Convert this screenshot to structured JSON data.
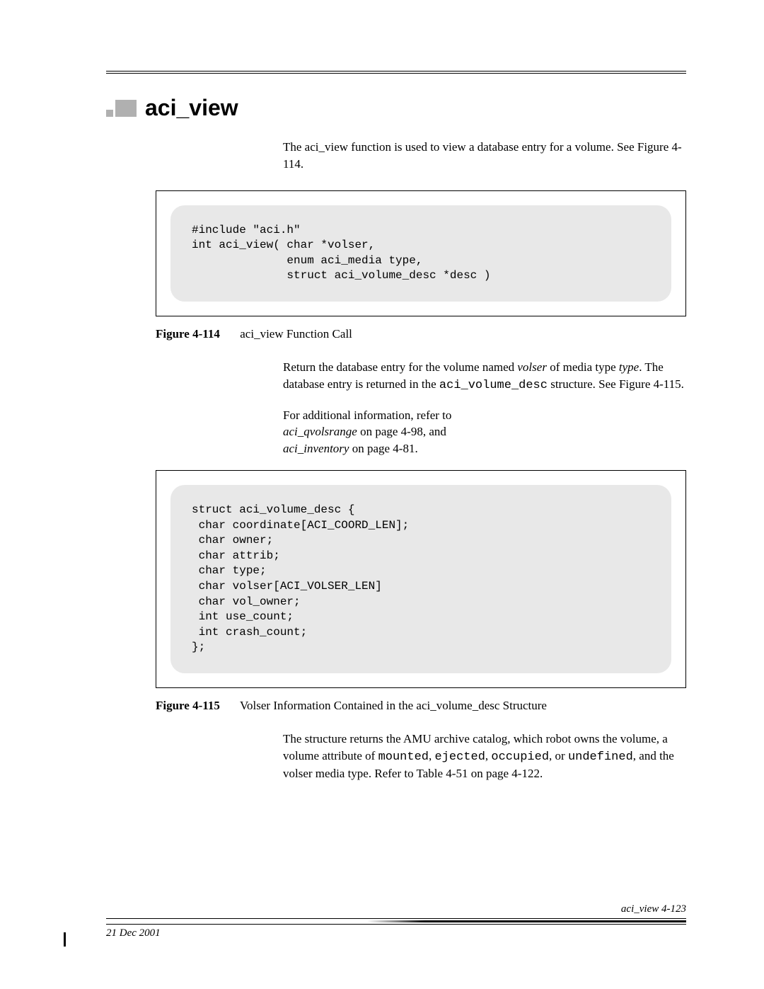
{
  "heading": "aci_view",
  "intro": "The aci_view function is used to view a database entry for a volume. See Figure 4-114.",
  "code1": "#include \"aci.h\"\nint aci_view( char *volser,\n              enum aci_media type,\n              struct aci_volume_desc *desc )",
  "fig1_label": "Figure 4-114",
  "fig1_caption": "aci_view Function Call",
  "para1_pre": "Return the database entry for the volume named ",
  "para1_volser": "volser",
  "para1_mid1": " of media type ",
  "para1_type": "type",
  "para1_mid2": ". The database entry is returned in the ",
  "para1_struct": "aci_volume_desc",
  "para1_end": " structure. See Figure 4-115.",
  "para2_pre": "For additional information, refer to ",
  "para2_ref1": "aci_qvolsrange",
  "para2_ref1_page": "  on page 4-98, and ",
  "para2_ref2": "aci_inventory",
  "para2_ref2_page": "  on page 4-81.",
  "code2": "struct aci_volume_desc {\n char coordinate[ACI_COORD_LEN];\n char owner;\n char attrib;\n char type;\n char volser[ACI_VOLSER_LEN]\n char vol_owner;\n int use_count;\n int crash_count;\n};",
  "fig2_label": "Figure 4-115",
  "fig2_caption": "Volser Information Contained in the aci_volume_desc Structure",
  "para3_pre": "The structure returns the AMU archive catalog, which robot owns the volume, a volume attribute of ",
  "para3_m1": "mounted",
  "para3_c1": ", ",
  "para3_m2": "ejected",
  "para3_c2": ", ",
  "para3_m3": "occupied",
  "para3_c3": ", or ",
  "para3_m4": "undefined",
  "para3_end": ", and the volser media type. Refer to Table 4-51 on page 4-122.",
  "footer_date": "21 Dec 2001",
  "footer_section": "aci_view",
  "footer_page": "4-123"
}
